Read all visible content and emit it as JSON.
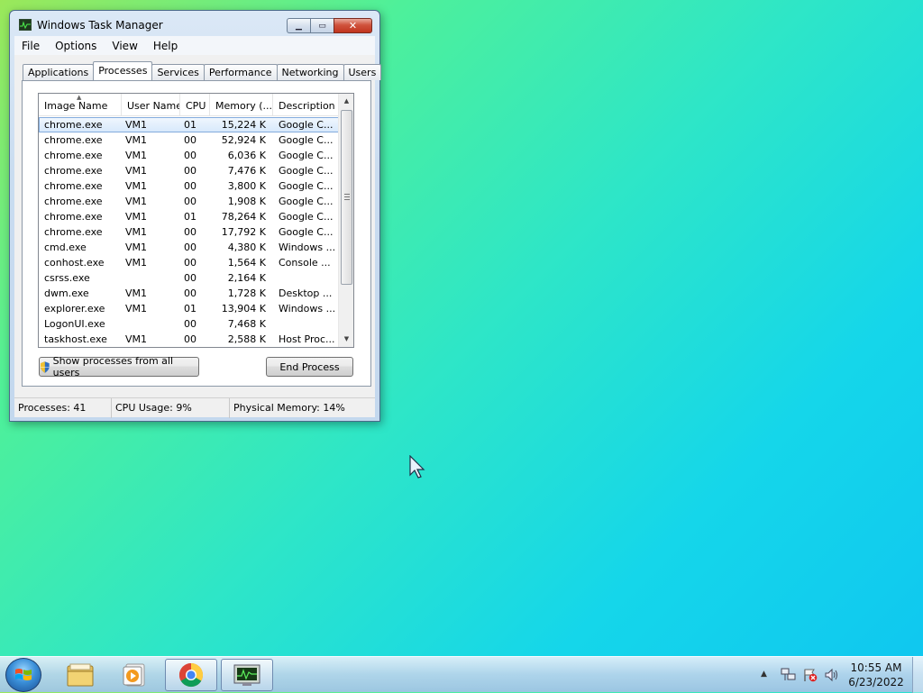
{
  "window": {
    "title": "Windows Task Manager",
    "menu": [
      "File",
      "Options",
      "View",
      "Help"
    ],
    "tabs": [
      "Applications",
      "Processes",
      "Services",
      "Performance",
      "Networking",
      "Users"
    ],
    "active_tab": "Processes"
  },
  "processes": {
    "columns": [
      "Image Name",
      "User Name",
      "CPU",
      "Memory (...",
      "Description"
    ],
    "rows": [
      {
        "image": "chrome.exe",
        "user": "VM1",
        "cpu": "01",
        "memory": "15,224 K",
        "desc": "Google C..."
      },
      {
        "image": "chrome.exe",
        "user": "VM1",
        "cpu": "00",
        "memory": "52,924 K",
        "desc": "Google C..."
      },
      {
        "image": "chrome.exe",
        "user": "VM1",
        "cpu": "00",
        "memory": "6,036 K",
        "desc": "Google C..."
      },
      {
        "image": "chrome.exe",
        "user": "VM1",
        "cpu": "00",
        "memory": "7,476 K",
        "desc": "Google C..."
      },
      {
        "image": "chrome.exe",
        "user": "VM1",
        "cpu": "00",
        "memory": "3,800 K",
        "desc": "Google C..."
      },
      {
        "image": "chrome.exe",
        "user": "VM1",
        "cpu": "00",
        "memory": "1,908 K",
        "desc": "Google C..."
      },
      {
        "image": "chrome.exe",
        "user": "VM1",
        "cpu": "01",
        "memory": "78,264 K",
        "desc": "Google C..."
      },
      {
        "image": "chrome.exe",
        "user": "VM1",
        "cpu": "00",
        "memory": "17,792 K",
        "desc": "Google C..."
      },
      {
        "image": "cmd.exe",
        "user": "VM1",
        "cpu": "00",
        "memory": "4,380 K",
        "desc": "Windows ..."
      },
      {
        "image": "conhost.exe",
        "user": "VM1",
        "cpu": "00",
        "memory": "1,564 K",
        "desc": "Console ..."
      },
      {
        "image": "csrss.exe",
        "user": "",
        "cpu": "00",
        "memory": "2,164 K",
        "desc": ""
      },
      {
        "image": "dwm.exe",
        "user": "VM1",
        "cpu": "00",
        "memory": "1,728 K",
        "desc": "Desktop ..."
      },
      {
        "image": "explorer.exe",
        "user": "VM1",
        "cpu": "01",
        "memory": "13,904 K",
        "desc": "Windows ..."
      },
      {
        "image": "LogonUI.exe",
        "user": "",
        "cpu": "00",
        "memory": "7,468 K",
        "desc": ""
      },
      {
        "image": "taskhost.exe",
        "user": "VM1",
        "cpu": "00",
        "memory": "2,588 K",
        "desc": "Host Proc..."
      }
    ],
    "selected_index": 0
  },
  "buttons": {
    "show_all": "Show processes from all users",
    "end_process": "End Process"
  },
  "status": {
    "processes": "Processes: 41",
    "cpu": "CPU Usage: 9%",
    "memory": "Physical Memory: 14%"
  },
  "taskbar": {
    "pinned": [
      "folder-icon",
      "media-player-icon",
      "chrome-icon",
      "task-manager-icon"
    ],
    "tray_icons": [
      "network-icon",
      "action-center-icon",
      "volume-icon"
    ],
    "time": "10:55 AM",
    "date": "6/23/2022"
  }
}
